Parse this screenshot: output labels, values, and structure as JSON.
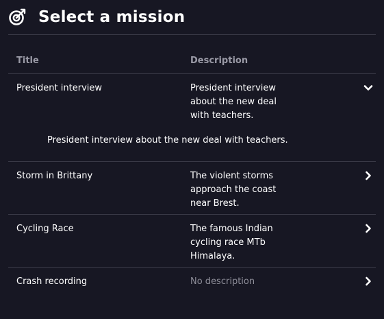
{
  "header": {
    "title": "Select a mission",
    "icon": "target-icon"
  },
  "table": {
    "columns": [
      "Title",
      "Description"
    ],
    "rows": [
      {
        "title": "President interview",
        "description": "President interview about the new deal with teachers.",
        "desc_lines": [
          "President interview",
          "about the new deal",
          "with teachers."
        ],
        "expanded": true,
        "expanded_text": "President interview about the new deal with teachers.",
        "chevron": "chevron-down-icon"
      },
      {
        "title": "Storm in Brittany",
        "description": "The violent storms approach the coast near Brest.",
        "desc_lines": [
          "The violent storms",
          "approach the coast",
          "near Brest."
        ],
        "expanded": false,
        "chevron": "chevron-right-icon"
      },
      {
        "title": "Cycling Race",
        "description": "The famous Indian cycling race MTb Himalaya.",
        "desc_lines": [
          "The famous Indian",
          "cycling race MTb",
          "Himalaya."
        ],
        "expanded": false,
        "chevron": "chevron-right-icon"
      },
      {
        "title": "Crash recording",
        "description": "No description",
        "desc_lines": [
          "No description"
        ],
        "expanded": false,
        "muted": true,
        "chevron": "chevron-right-icon"
      }
    ]
  },
  "colors": {
    "background": "#171723",
    "divider": "#3a3a47",
    "header_text": "#9a9aa6",
    "muted_text": "#8e8e99"
  }
}
